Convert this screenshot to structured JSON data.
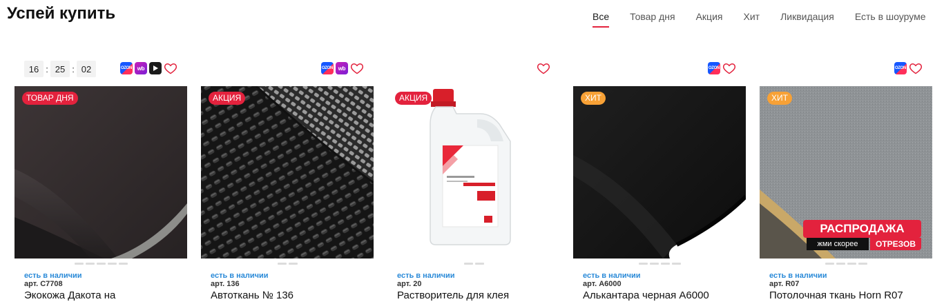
{
  "section": {
    "title": "Успей купить"
  },
  "tabs": [
    {
      "label": "Все",
      "active": true
    },
    {
      "label": "Товар дня",
      "active": false
    },
    {
      "label": "Акция",
      "active": false
    },
    {
      "label": "Хит",
      "active": false
    },
    {
      "label": "Ликвидация",
      "active": false
    },
    {
      "label": "Есть в шоуруме",
      "active": false
    }
  ],
  "colors": {
    "accent": "#e3223d",
    "badge_hit": "#f7a136",
    "stock": "#2a8ad8"
  },
  "timer": {
    "hours": "16",
    "minutes": "25",
    "seconds": "02",
    "separator": ":"
  },
  "marketplace_labels": {
    "ozon": "OZON",
    "wb": "wb"
  },
  "promo": {
    "line1": "РАСПРОДАЖА",
    "line2a": "жми скорее",
    "line2b": "ОТРЕЗОВ"
  },
  "products": [
    {
      "badge": "ТОВАР ДНЯ",
      "stock": "есть в наличии",
      "art": "арт. C7708",
      "name": "Экокожа Дакота на",
      "icons": [
        "ozon-icon",
        "wb-icon",
        "video-icon",
        "heart-icon"
      ]
    },
    {
      "badge": "АКЦИЯ",
      "stock": "есть в наличии",
      "art": "арт. 136",
      "name": "Автоткань № 136",
      "icons": [
        "ozon-icon",
        "wb-icon",
        "heart-icon"
      ]
    },
    {
      "badge": "АКЦИЯ",
      "stock": "есть в наличии",
      "art": "арт. 20",
      "name": "Растворитель для клея",
      "icons": [
        "heart-icon"
      ]
    },
    {
      "badge": "ХИТ",
      "stock": "есть в наличии",
      "art": "арт. A6000",
      "name": "Алькантара черная A6000",
      "icons": [
        "ozon-icon",
        "heart-icon"
      ]
    },
    {
      "badge": "ХИТ",
      "stock": "есть в наличии",
      "art": "арт. R07",
      "name": "Потолочная ткань Horn R07",
      "icons": [
        "ozon-icon",
        "heart-icon"
      ]
    }
  ]
}
